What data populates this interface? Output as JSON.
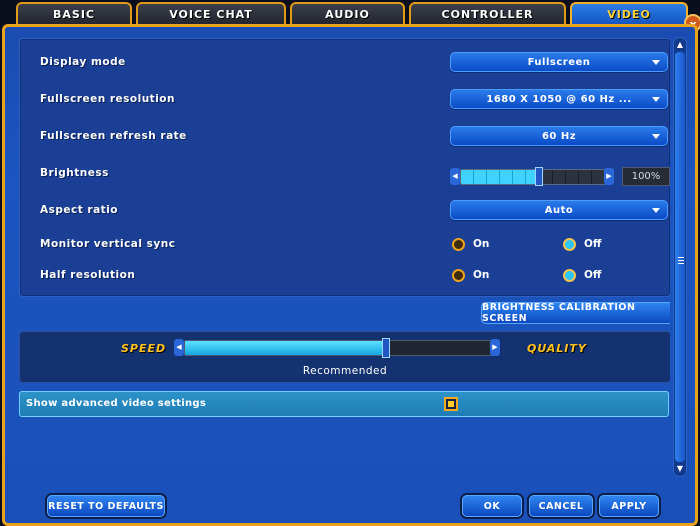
{
  "tabs": [
    {
      "label": "BASIC",
      "active": false
    },
    {
      "label": "VOICE CHAT",
      "active": false
    },
    {
      "label": "AUDIO",
      "active": false
    },
    {
      "label": "CONTROLLER",
      "active": false
    },
    {
      "label": "VIDEO",
      "active": true
    }
  ],
  "close_label": "x",
  "settings": {
    "display_mode": {
      "label": "Display mode",
      "value": "Fullscreen"
    },
    "fullscreen_resolution": {
      "label": "Fullscreen resolution",
      "value": "1680 X 1050 @ 60 Hz ..."
    },
    "fullscreen_refresh_rate": {
      "label": "Fullscreen refresh rate",
      "value": "60 Hz"
    },
    "brightness": {
      "label": "Brightness",
      "value_text": "100%",
      "level": 0.55
    },
    "aspect_ratio": {
      "label": "Aspect ratio",
      "value": "Auto"
    },
    "monitor_vertical_sync": {
      "label": "Monitor vertical sync",
      "on_label": "On",
      "off_label": "Off",
      "selected": "off"
    },
    "half_resolution": {
      "label": "Half resolution",
      "on_label": "On",
      "off_label": "Off",
      "selected": "off"
    }
  },
  "brightness_calibration_label": "BRIGHTNESS CALIBRATION SCREEN",
  "quality": {
    "speed_label": "SPEED",
    "quality_label": "QUALITY",
    "level": 0.66,
    "preset_text": "Recommended"
  },
  "advanced": {
    "label": "Show advanced video settings",
    "checked": true
  },
  "buttons": {
    "reset": "RESET TO DEFAULTS",
    "ok": "OK",
    "cancel": "CANCEL",
    "apply": "APPLY"
  },
  "colors": {
    "accent_orange": "#e8a21c",
    "panel_blue": "#1a3f94",
    "highlight_cyan": "#2ec6ff",
    "speed_quality_yellow": "#ffc21f"
  }
}
